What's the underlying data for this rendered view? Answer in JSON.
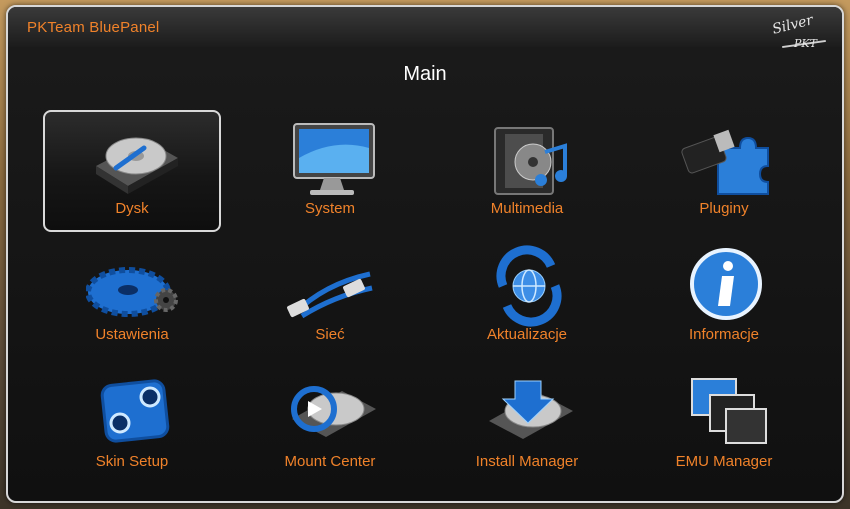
{
  "window": {
    "title": "PKTeam BluePanel"
  },
  "logo": {
    "line1": "Silver",
    "line2": "PKT"
  },
  "screen": {
    "title": "Main"
  },
  "colors": {
    "accent": "#f0822a",
    "icon_blue": "#1e6fd0",
    "frame": "#d9d9d9"
  },
  "menu": {
    "selected_index": 0,
    "items": [
      {
        "label": "Dysk",
        "icon": "hard-disk-icon"
      },
      {
        "label": "System",
        "icon": "monitor-icon"
      },
      {
        "label": "Multimedia",
        "icon": "film-music-icon"
      },
      {
        "label": "Pluginy",
        "icon": "usb-puzzle-icon"
      },
      {
        "label": "Ustawienia",
        "icon": "gear-icon"
      },
      {
        "label": "Sieć",
        "icon": "network-cable-icon"
      },
      {
        "label": "Aktualizacje",
        "icon": "globe-refresh-icon"
      },
      {
        "label": "Informacje",
        "icon": "info-icon"
      },
      {
        "label": "Skin Setup",
        "icon": "skin-setup-icon"
      },
      {
        "label": "Mount Center",
        "icon": "disk-mount-icon"
      },
      {
        "label": "Install Manager",
        "icon": "disk-install-icon"
      },
      {
        "label": "EMU Manager",
        "icon": "windows-stack-icon"
      }
    ]
  }
}
